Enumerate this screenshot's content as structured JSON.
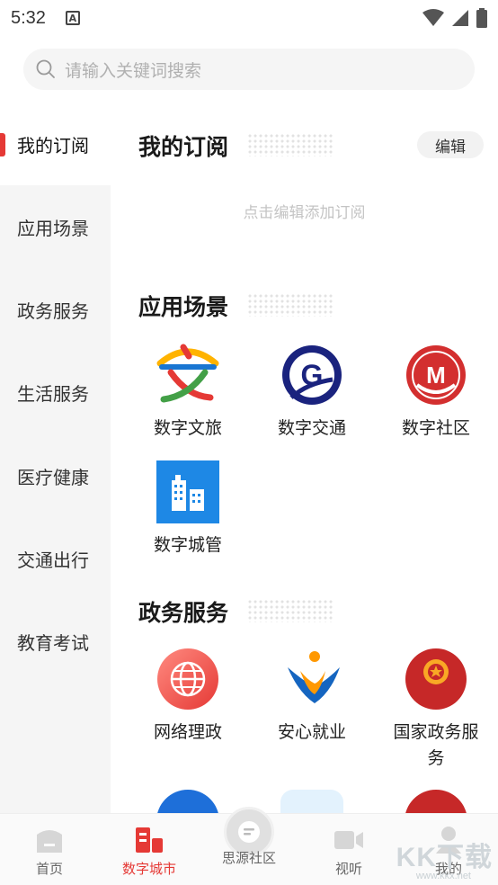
{
  "status_bar": {
    "time": "5:32",
    "a_badge": "A"
  },
  "search": {
    "placeholder": "请输入关键词搜索"
  },
  "sidebar": {
    "items": [
      {
        "label": "我的订阅",
        "active": true
      },
      {
        "label": "应用场景"
      },
      {
        "label": "政务服务"
      },
      {
        "label": "生活服务"
      },
      {
        "label": "医疗健康"
      },
      {
        "label": "交通出行"
      },
      {
        "label": "教育考试"
      }
    ]
  },
  "subscriptions": {
    "title": "我的订阅",
    "edit_label": "编辑",
    "hint": "点击编辑添加订阅"
  },
  "scenes": {
    "title": "应用场景",
    "apps": [
      {
        "label": "数字文旅",
        "icon": "culture-tourism-icon"
      },
      {
        "label": "数字交通",
        "icon": "transport-icon"
      },
      {
        "label": "数字社区",
        "icon": "community-icon"
      },
      {
        "label": "数字城管",
        "icon": "city-management-icon"
      }
    ]
  },
  "gov": {
    "title": "政务服务",
    "apps": [
      {
        "label": "网络理政",
        "icon": "globe-icon"
      },
      {
        "label": "安心就业",
        "icon": "employment-icon"
      },
      {
        "label": "国家政务服务",
        "icon": "national-emblem-icon",
        "badge_text": "国家政务服务"
      }
    ]
  },
  "bottom_nav": {
    "items": [
      {
        "label": "首页",
        "icon": "home-icon"
      },
      {
        "label": "数字城市",
        "icon": "city-icon",
        "active": true
      },
      {
        "label": "思源社区",
        "icon": "chat-icon"
      },
      {
        "label": "视听",
        "icon": "video-icon"
      },
      {
        "label": "我的",
        "icon": "profile-icon"
      }
    ]
  },
  "watermark": {
    "text": "KK下载",
    "url": "www.kkx.net"
  },
  "colors": {
    "accent": "#e53935",
    "sidebar_bg": "#f5f5f5"
  }
}
